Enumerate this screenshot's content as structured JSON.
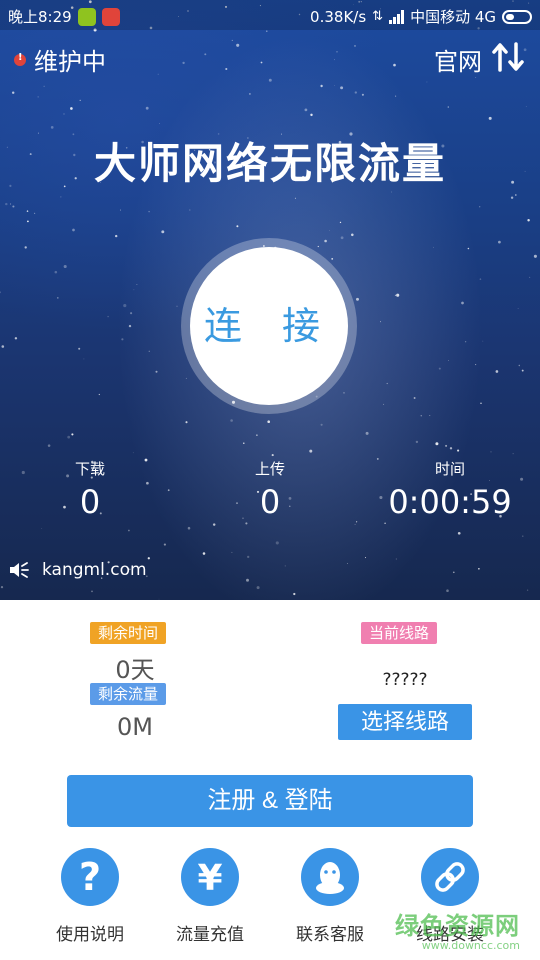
{
  "status_bar": {
    "time": "晚上8:29",
    "speed": "0.38K/s",
    "carrier": "中国移动 4G"
  },
  "top_bar": {
    "maintenance": "维护中",
    "official_site": "官网",
    "switch_icon": "switch-arrows-icon"
  },
  "app_title": "大师网络无限流量",
  "connect_button": "连 接",
  "stats": {
    "download": {
      "label": "下载",
      "value": "0"
    },
    "upload": {
      "label": "上传",
      "value": "0"
    },
    "time": {
      "label": "时间",
      "value": "0:00:59"
    }
  },
  "site": {
    "text": "kangml.com",
    "icon": "speaker-icon"
  },
  "account": {
    "remaining_time_label": "剩余时间",
    "remaining_time_value": "0天",
    "remaining_flow_label": "剩余流量",
    "remaining_flow_value": "0M"
  },
  "line": {
    "current_label": "当前线路",
    "current_value": "?????",
    "choose_button": "选择线路"
  },
  "login_button": "注册 & 登陆",
  "bottom_nav": [
    {
      "label": "使用说明",
      "icon": "question-icon"
    },
    {
      "label": "流量充值",
      "icon": "yen-icon"
    },
    {
      "label": "联系客服",
      "icon": "qq-penguin-icon"
    },
    {
      "label": "线路安装",
      "icon": "link-icon"
    }
  ],
  "watermark": {
    "main": "绿色资源网",
    "sub": "www.downcc.com"
  },
  "colors": {
    "accent_blue": "#3a94e6",
    "tag_orange": "#f0a325",
    "tag_pink": "#f07fb0",
    "tag_blue": "#5b9be8"
  }
}
